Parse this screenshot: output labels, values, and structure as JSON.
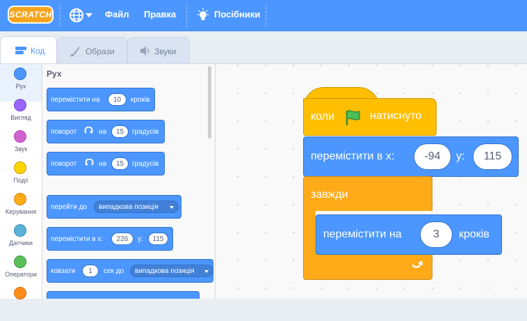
{
  "menu": {
    "logo_text": "SCRATCH",
    "file": "Файл",
    "edit": "Правка",
    "tutorials": "Посібники"
  },
  "tabs": [
    {
      "label": "Код",
      "active": true
    },
    {
      "label": "Образи",
      "active": false
    },
    {
      "label": "Звуки",
      "active": false
    }
  ],
  "categories": [
    {
      "label": "Рух",
      "color": "#4c97ff",
      "selected": true
    },
    {
      "label": "Вигляд",
      "color": "#9966ff",
      "selected": false
    },
    {
      "label": "Звук",
      "color": "#cf63cf",
      "selected": false
    },
    {
      "label": "Події",
      "color": "#ffd500",
      "selected": false
    },
    {
      "label": "Керування",
      "color": "#ffab19",
      "selected": false
    },
    {
      "label": "Датчики",
      "color": "#5cb1d6",
      "selected": false
    },
    {
      "label": "Оператори",
      "color": "#59c059",
      "selected": false
    }
  ],
  "palette": {
    "title": "Рух",
    "move": {
      "text": "перемістити на",
      "value": "10",
      "suffix": "кроків"
    },
    "turn_right": {
      "text": "поворот",
      "on": "на",
      "value": "15",
      "suffix": "градусів"
    },
    "turn_left": {
      "text": "поворот",
      "on": "на",
      "value": "15",
      "suffix": "градусів"
    },
    "goto": {
      "text": "перейти до",
      "option": "випадкова позиція"
    },
    "goto_xy": {
      "text": "перемістити в х:",
      "x": "226",
      "ylabel": "у:",
      "y": "115"
    },
    "glide": {
      "text": "ковзати",
      "value": "1",
      "mid": "сек до",
      "option": "випадкова позиція"
    }
  },
  "script": {
    "hat": {
      "text_before": "коли",
      "text_after": "натиснуто"
    },
    "goto_xy": {
      "text": "перемістити в х:",
      "x": "-94",
      "ylabel": "у:",
      "y": "115"
    },
    "forever": {
      "text": "завжди"
    },
    "move": {
      "text": "перемістити на",
      "value": "3",
      "suffix": "кроків"
    }
  }
}
